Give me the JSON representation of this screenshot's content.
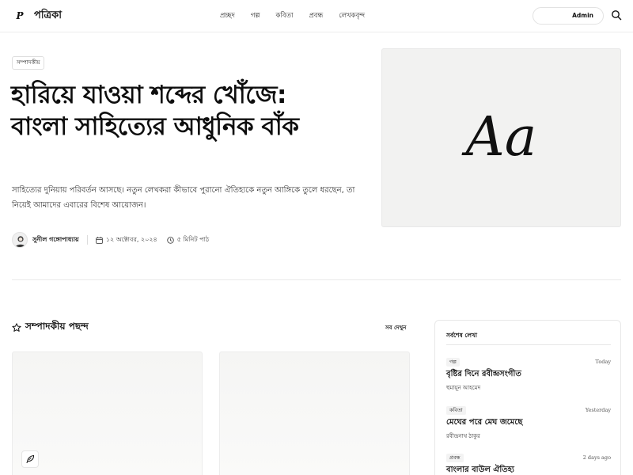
{
  "header": {
    "logo_mark": "P",
    "logo_text": "পত্রিকা",
    "nav": [
      "প্রচ্ছদ",
      "গল্প",
      "কবিতা",
      "প্রবন্ধ",
      "লেখকবৃন্দ"
    ],
    "admin_label": "Admin"
  },
  "hero": {
    "badge": "সম্পাদকীয়",
    "title_line1": "হারিয়ে যাওয়া শব্দের খোঁজে:",
    "title_line2": "বাংলা সাহিত্যের আধুনিক বাঁক",
    "description": "সাহিত্যের দুনিয়ায় পরিবর্তন আসছে। নতুন লেখকরা কীভাবে পুরানো ঐতিহ্যকে নতুন আঙ্গিকে তুলে ধরছেন, তা নিয়েই আমাদের এবারের বিশেষ আয়োজন।",
    "author": "সুনীল গঙ্গোপাধ্যায়",
    "date": "১২ অক্টোবর, ২০২৪",
    "read_time": "৫ মিনিট পাঠ",
    "image_text": "Aa"
  },
  "picks": {
    "title": "সম্পাদকীয় পছন্দ",
    "see_all": "সব দেখুন"
  },
  "latest": {
    "title": "সর্বশেষ লেখা",
    "items": [
      {
        "tag": "গল্প",
        "time": "Today",
        "title": "বৃষ্টির দিনে রবীন্দ্রসংগীত",
        "author": "হুমায়ূন আহমেদ"
      },
      {
        "tag": "কবিতা",
        "time": "Yesterday",
        "title": "মেঘের পরে মেঘ জমেছে",
        "author": "রবীন্দ্রনাথ ঠাকুর"
      },
      {
        "tag": "প্রবন্ধ",
        "time": "2 days ago",
        "title": "বাংলার বাউল ঐতিহ্য",
        "author": ""
      }
    ]
  },
  "colors": {
    "text": "#111111",
    "border": "#e8e8e8",
    "image_bg": "#f2f2f1"
  }
}
